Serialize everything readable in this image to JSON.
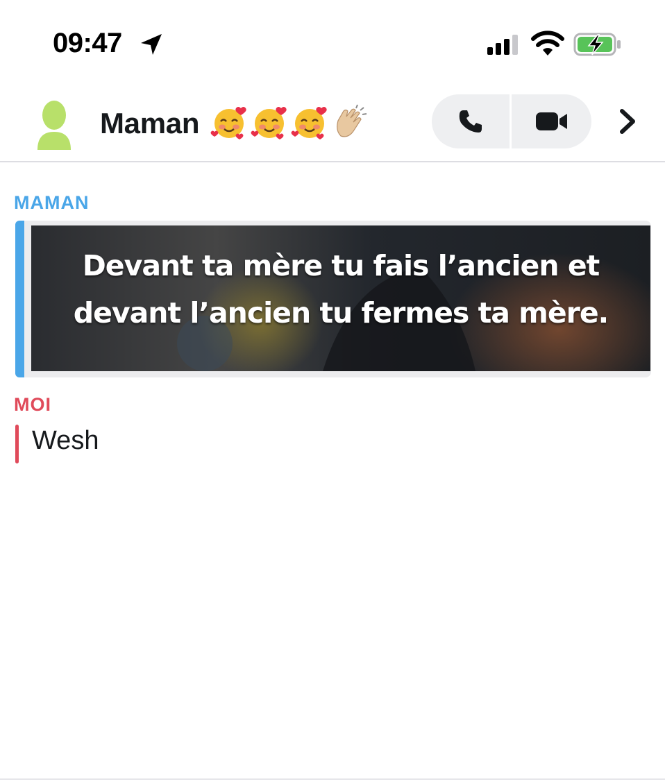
{
  "status_bar": {
    "time": "09:47",
    "location_icon": "location-arrow-icon",
    "signal_icon": "cellular-signal-icon",
    "wifi_icon": "wifi-icon",
    "battery_icon": "battery-charging-icon",
    "battery_color": "#58c359"
  },
  "header": {
    "title": "Maman",
    "title_emojis": [
      "smiling-face-with-hearts",
      "smiling-face-with-hearts",
      "smiling-face-with-hearts",
      "clapping-hands"
    ],
    "avatar_icon": "bitmoji-avatar-placeholder-icon",
    "avatar_color": "#b8e06a",
    "call_button_icon": "phone-icon",
    "video_button_icon": "video-camera-icon",
    "more_icon": "chevron-right-icon"
  },
  "messages": [
    {
      "sender": "MAMAN",
      "sender_color": "#4aa6e8",
      "type": "media",
      "caption": "Devant ta mère tu fais l’ancien et\ndevant l’ancien tu fermes ta mère."
    },
    {
      "sender": "MOI",
      "sender_color": "#e04a5a",
      "type": "text",
      "text": "Wesh"
    }
  ]
}
